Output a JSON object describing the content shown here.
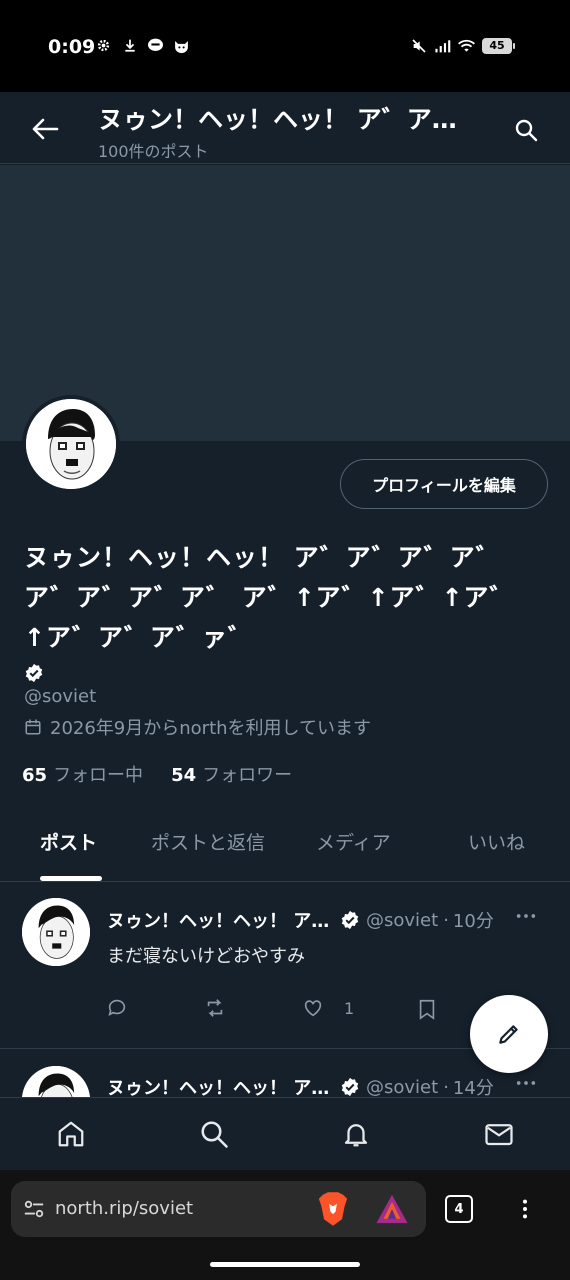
{
  "status_bar": {
    "time": "0:09",
    "battery": "45"
  },
  "header": {
    "title": "ヌゥン！ヘッ！ヘッ！ ア゛ア…",
    "subtitle": "100件のポスト"
  },
  "profile": {
    "edit_button": "プロフィールを編集",
    "display_name": "ヌゥン！ヘッ！ヘッ！ ア゛ア゛ア゛ア゛ア゛ア゛ア゛ア゛ ア゛↑ア゛↑ア゛↑ア゛↑ア゛ア゛ア゛ァ゛",
    "handle": "@soviet",
    "joined": "2026年9月からnorthを利用しています",
    "following_count": "65",
    "following_label": "フォロー中",
    "followers_count": "54",
    "followers_label": "フォロワー"
  },
  "tabs": [
    {
      "label": "ポスト",
      "active": true
    },
    {
      "label": "ポストと返信",
      "active": false
    },
    {
      "label": "メディア",
      "active": false
    },
    {
      "label": "いいね",
      "active": false
    }
  ],
  "posts": [
    {
      "name": "ヌゥン！ヘッ！ヘッ！ ア゛ア゛",
      "handle": "@soviet",
      "time": "10分",
      "text": "まだ寝ないけどおやすみ",
      "likes": "1"
    },
    {
      "name": "ヌゥン！ヘッ！ヘッ！ ア゛ア゛",
      "handle": "@soviet",
      "time": "14分"
    }
  ],
  "browser": {
    "url": "north.rip/soviet",
    "tab_count": "4"
  },
  "colors": {
    "background": "#15202b",
    "banner": "#22303c",
    "muted": "#8b98a5",
    "divider": "#2f3b47"
  }
}
